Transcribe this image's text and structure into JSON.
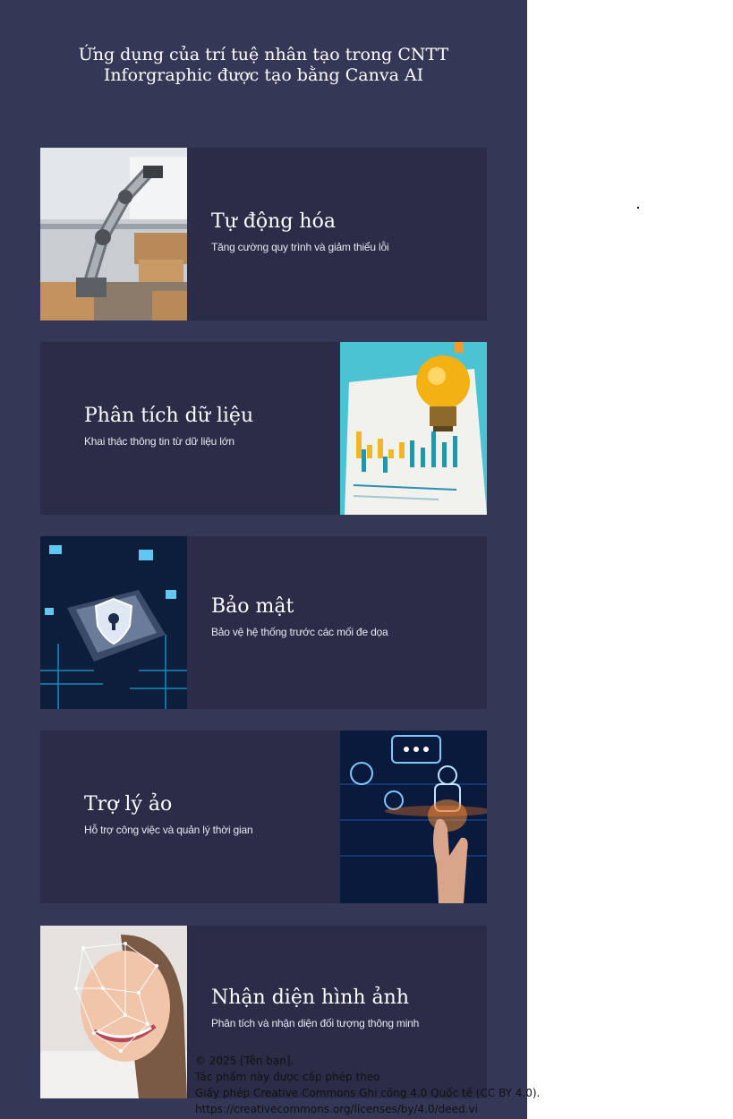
{
  "header": {
    "title_line1": "Ứng dụng của trí tuệ nhân tạo trong CNTT",
    "title_line2": "Inforgraphic được tạo bằng Canva AI"
  },
  "cards": [
    {
      "title": "Tự động hóa",
      "subtitle": "Tăng cường quy trình và giảm thiểu lỗi",
      "image_icon": "robot-arm-warehouse"
    },
    {
      "title": "Phân tích dữ liệu",
      "subtitle": "Khai thác thông tin từ dữ liệu lớn",
      "image_icon": "lightbulb-bar-chart"
    },
    {
      "title": "Bảo mật",
      "subtitle": "Bảo vệ hệ thống trước các mối đe dọa",
      "image_icon": "shield-lock-chip"
    },
    {
      "title": "Trợ lý ảo",
      "subtitle": "Hỗ trợ công việc và quản lý thời gian",
      "image_icon": "hand-holding-robot"
    },
    {
      "title": "Nhận diện hình ảnh",
      "subtitle": "Phân tích và nhận diện đối tượng thông minh",
      "image_icon": "face-recognition-mesh"
    }
  ],
  "license": {
    "line1": "© 2025 [Tên bạn].",
    "line2": "Tác phẩm này được cấp phép theo",
    "line3": "Giấy phép Creative Commons Ghi công 4.0 Quốc tế (CC BY 4.0).",
    "line4": "https://creativecommons.org/licenses/by/4.0/deed.vi"
  },
  "colors": {
    "panel": "#353757",
    "card": "#2a2c48",
    "text": "#ffffff"
  }
}
